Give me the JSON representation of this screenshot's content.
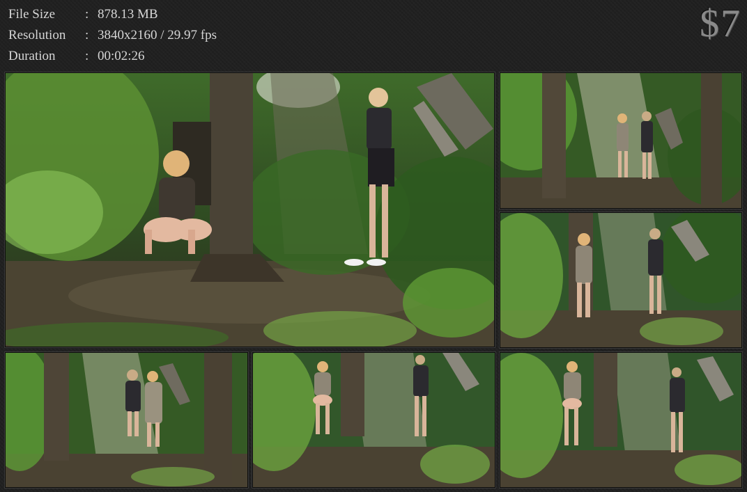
{
  "info": {
    "file_size_label": "File Size",
    "file_size_value": "878.13 MB",
    "resolution_label": "Resolution",
    "resolution_value": "3840x2160 / 29.97 fps",
    "duration_label": "Duration",
    "duration_value": "00:02:26",
    "separator": ":"
  },
  "price": "$7",
  "colors": {
    "background": "#202020",
    "text": "#d6d6d6",
    "price": "#8a8a8a"
  },
  "thumbnails": [
    {
      "id": "frame-1",
      "size": "large"
    },
    {
      "id": "frame-2",
      "size": "small"
    },
    {
      "id": "frame-3",
      "size": "small"
    },
    {
      "id": "frame-4",
      "size": "small"
    },
    {
      "id": "frame-5",
      "size": "small"
    },
    {
      "id": "frame-6",
      "size": "small"
    }
  ]
}
